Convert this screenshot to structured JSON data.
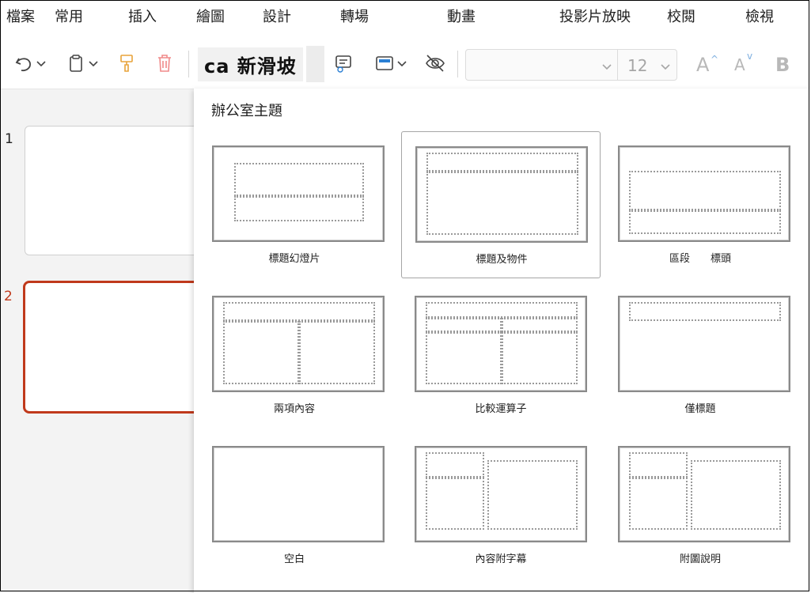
{
  "menu": [
    "檔案",
    "常用",
    "插入",
    "繪圖",
    "設計",
    "轉場",
    "動畫",
    "投影片放映",
    "校閱",
    "檢視"
  ],
  "toolbar": {
    "layout_label": "ca 新滑坡",
    "font_size": "12",
    "increase_font": "A",
    "decrease_font": "A",
    "bold": "B",
    "icons": [
      "undo-icon",
      "clipboard-icon",
      "format-painter-icon",
      "delete-icon",
      "comment-icon",
      "layout-icon",
      "hide-icon"
    ]
  },
  "slides": [
    {
      "number": "1"
    },
    {
      "number": "2"
    }
  ],
  "dropdown": {
    "title": "辦公室主題",
    "layouts": [
      {
        "name": "標題幻燈片"
      },
      {
        "name": "標題及物件"
      },
      {
        "name": "區段　　標頭"
      },
      {
        "name": "兩項內容"
      },
      {
        "name": "比較運算子"
      },
      {
        "name": "僅標題"
      },
      {
        "name": "空白"
      },
      {
        "name": "內容附字幕"
      },
      {
        "name": "附圖說明"
      }
    ]
  },
  "colors": {
    "accent": "#c0391b",
    "pane_bg": "#f3f3f3",
    "placeholder": "#9a9a9a"
  }
}
